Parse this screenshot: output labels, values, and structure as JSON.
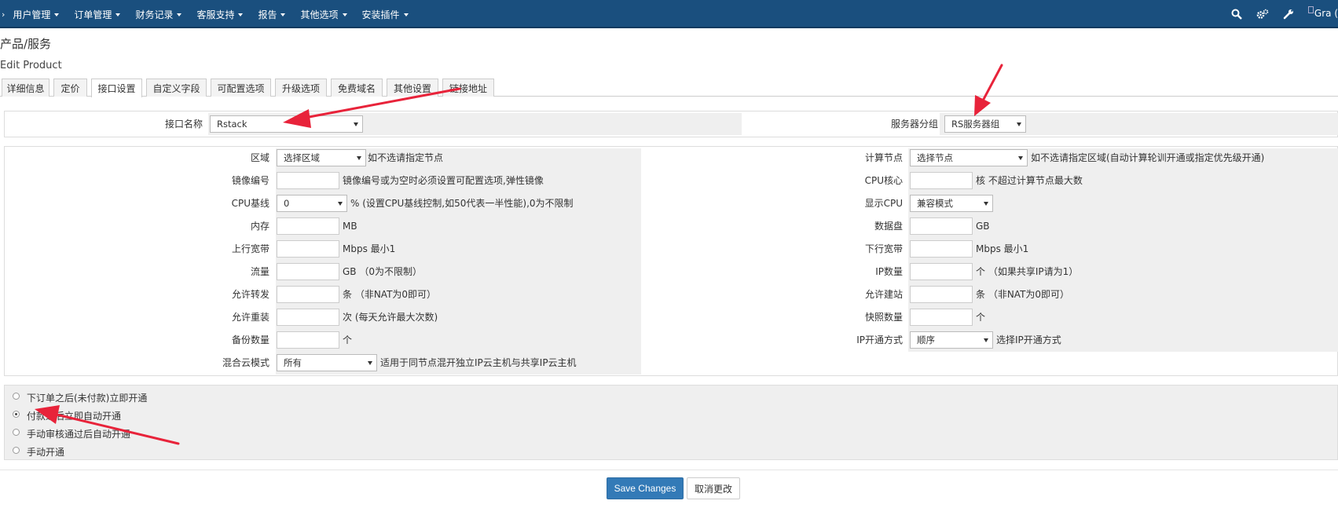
{
  "nav": {
    "dot": "›",
    "items": [
      "用户管理",
      "订单管理",
      "财务记录",
      "客服支持",
      "报告",
      "其他选项",
      "安装插件"
    ],
    "avatar_alt": "Gra",
    "avatar_tail": "("
  },
  "page": {
    "title": "产品/服务",
    "subtitle": "Edit Product"
  },
  "tabs": [
    "详细信息",
    "定价",
    "接口设置",
    "自定义字段",
    "可配置选项",
    "升级选项",
    "免费域名",
    "其他设置",
    "链接地址"
  ],
  "active_tab": "接口设置",
  "module": {
    "name_label": "接口名称",
    "name_value": "Rstack",
    "group_label": "服务器分组",
    "group_value": "RS服务器组"
  },
  "config": {
    "left": [
      {
        "label": "区域",
        "type": "select",
        "value": "选择区域",
        "note": "如不选请指定节点"
      },
      {
        "label": "镜像编号",
        "type": "input",
        "value": "",
        "note": "镜像编号或为空时必须设置可配置选项,弹性镜像"
      },
      {
        "label": "CPU基线",
        "type": "select",
        "value": "0",
        "note": "% (设置CPU基线控制,如50代表一半性能),0为不限制"
      },
      {
        "label": "内存",
        "type": "input",
        "value": "",
        "note": "MB"
      },
      {
        "label": "上行宽带",
        "type": "input",
        "value": "",
        "note": "Mbps 最小1"
      },
      {
        "label": "流量",
        "type": "input",
        "value": "",
        "note": "GB （0为不限制）"
      },
      {
        "label": "允许转发",
        "type": "input",
        "value": "",
        "note": "条 （非NAT为0即可）"
      },
      {
        "label": "允许重装",
        "type": "input",
        "value": "",
        "note": "次 (每天允许最大次数)"
      },
      {
        "label": "备份数量",
        "type": "input",
        "value": "",
        "note": "个"
      },
      {
        "label": "混合云模式",
        "type": "select",
        "value": "所有",
        "note": "适用于同节点混开独立IP云主机与共享IP云主机"
      }
    ],
    "right": [
      {
        "label": "计算节点",
        "type": "select",
        "value": "选择节点",
        "note": "如不选请指定区域(自动计算轮训开通或指定优先级开通)"
      },
      {
        "label": "CPU核心",
        "type": "input",
        "value": "",
        "note": "核 不超过计算节点最大数"
      },
      {
        "label": "显示CPU",
        "type": "select",
        "value": "兼容模式",
        "note": ""
      },
      {
        "label": "数据盘",
        "type": "input",
        "value": "",
        "note": "GB"
      },
      {
        "label": "下行宽带",
        "type": "input",
        "value": "",
        "note": "Mbps 最小1"
      },
      {
        "label": "IP数量",
        "type": "input",
        "value": "",
        "note": "个 （如果共享IP请为1）"
      },
      {
        "label": "允许建站",
        "type": "input",
        "value": "",
        "note": "条 （非NAT为0即可）"
      },
      {
        "label": "快照数量",
        "type": "input",
        "value": "",
        "note": "个"
      },
      {
        "label": "IP开通方式",
        "type": "select",
        "value": "顺序",
        "note": "选择IP开通方式"
      }
    ]
  },
  "provision": {
    "options": [
      "下订单之后(未付款)立即开通",
      "付款之后立即自动开通",
      "手动审核通过后自动开通",
      "手动开通"
    ],
    "selected_index": 1
  },
  "buttons": {
    "save": "Save Changes",
    "cancel": "取消更改"
  },
  "colors": {
    "navbar": "#1a4f7e",
    "primary": "#337ab7",
    "annotation_arrow": "#e8233a"
  }
}
